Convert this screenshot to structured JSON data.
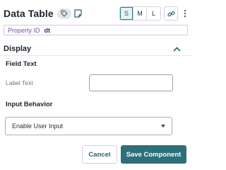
{
  "header": {
    "title": "Data Table",
    "size_options": [
      "S",
      "M",
      "L"
    ],
    "selected_size": "S",
    "icons": [
      "tag-icon",
      "note-icon",
      "link-icon",
      "more-vertical-icon"
    ]
  },
  "property": {
    "label": "Property ID",
    "value": "dt"
  },
  "section": {
    "title": "Display",
    "expanded": true
  },
  "field_text": {
    "heading": "Field Text",
    "label_text": "Label Text",
    "value": ""
  },
  "input_behavior": {
    "heading": "Input Behavior",
    "selected": "Enable User Input"
  },
  "footer": {
    "cancel_label": "Cancel",
    "save_label": "Save Component"
  },
  "colors": {
    "accent": "#2d6f7a",
    "property_border": "#d9c6e6",
    "property_text": "#7a4fa0"
  }
}
